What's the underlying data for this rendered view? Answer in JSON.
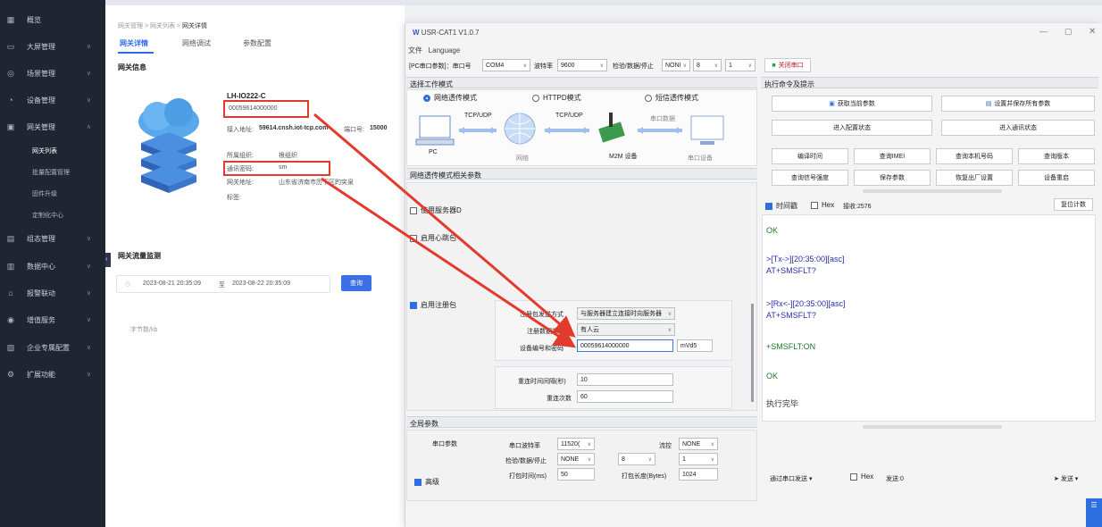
{
  "sidebar": {
    "items": [
      {
        "icon": "grid-icon",
        "label": "概览"
      },
      {
        "icon": "monitor-icon",
        "label": "大屏管理"
      },
      {
        "icon": "scene-icon",
        "label": "场景管理"
      },
      {
        "icon": "device-icon",
        "label": "设备管理"
      },
      {
        "icon": "gateway-icon",
        "label": "网关管理"
      },
      {
        "icon": "template-icon",
        "label": "组态管理"
      },
      {
        "icon": "chart-icon",
        "label": "数据中心"
      },
      {
        "icon": "alarm-icon",
        "label": "报警联动"
      },
      {
        "icon": "service-icon",
        "label": "增值服务"
      },
      {
        "icon": "enterprise-icon",
        "label": "企业专属配置"
      },
      {
        "icon": "plugin-icon",
        "label": "扩展功能"
      }
    ],
    "sub_items": [
      "网关列表",
      "批量配置管理",
      "固件升级",
      "定制化中心"
    ]
  },
  "breadcrumb": [
    "网关管理",
    "网关列表",
    "网关详情"
  ],
  "tabs": [
    "网关详情",
    "网络调试",
    "参数配置"
  ],
  "gateway_info": {
    "section": "网关信息",
    "model": "LH-IO222-C",
    "serial": "00059614000000",
    "access_addr_label": "接入地址:",
    "access_addr": "59614.cnsh.iot-tcp.com",
    "port_label": "端口号:",
    "port": "15000",
    "org_label": "所属组织:",
    "org": "根组织",
    "pass_label": "通讯密码:",
    "pass": "sm",
    "addr_label": "网关地址:",
    "addr": "山东省济南市历下区趵突泉",
    "tag_label": "标签:"
  },
  "traffic": {
    "section": "网关流量监测",
    "date_from": "2023-08-21 20:35:09",
    "sep": "至",
    "date_to": "2023-08-22 20:35:09",
    "query": "查询",
    "empty": "字节数/kb"
  },
  "window": {
    "title": "USR-CAT1 V1.0.7",
    "menu": [
      "文件",
      "Language"
    ],
    "port_label": "[PC串口参数]：串口号",
    "port": "COM4",
    "baud_label": "波特率",
    "baud": "9600",
    "parity_label": "检验/数据/停止",
    "parity": "NONI",
    "databits": "8",
    "stopbits": "1",
    "close_port": "关闭串口",
    "work_mode_title": "选择工作模式",
    "modes": [
      "网络透传模式",
      "HTTPD模式",
      "短信透传模式"
    ],
    "diagram": {
      "pc": "PC",
      "net": "网络",
      "dev": "M2M 设备",
      "serial_dev": "串口设备",
      "tcp1": "TCP/UDP",
      "tcp2": "TCP/UDP",
      "serial_data": "串口数据"
    },
    "net_params_title": "网络透传模式相关参数",
    "server_d": "使用服务器D",
    "heartbeat": "启用心跳包",
    "reg_pkg": "启用注册包",
    "reg_send_label": "注册包发送方式",
    "reg_send": "与服务器建立连接时向服务器",
    "reg_data_label": "注册数据类型",
    "reg_data": "有人云",
    "dev_id_label": "设备编号和密码",
    "dev_id": "00059614000000",
    "dev_pw": "mVd5",
    "reconnect_label": "重连时间间隔(秒)",
    "reconnect": "10",
    "retries_label": "重连次数",
    "retries": "60",
    "global_title": "全局参数",
    "serial_param": "串口参数",
    "s_baud_label": "串口波特率",
    "s_baud": "11520(",
    "flow_label": "流控",
    "flow": "NONE",
    "s_parity_label": "检验/数据/停止",
    "s_parity": "NONE",
    "s_data": "8",
    "s_stop": "1",
    "pack_time_label": "打包时间(ms)",
    "pack_time": "50",
    "pack_len_label": "打包长度(Bytes)",
    "pack_len": "1024",
    "advanced": "高级",
    "cmd_title": "执行命令及提示",
    "btn_get": "获取当前参数",
    "btn_save_all": "设置并保存所有参数",
    "btn_config": "进入配置状态",
    "btn_comm": "进入通讯状态",
    "grid_btns": [
      "编译时间",
      "查询IMEI",
      "查询本机号码",
      "查询版本",
      "查询信号强度",
      "保存参数",
      "恢复出厂设置",
      "设备重启"
    ],
    "timestamp": "时间戳",
    "hex": "Hex",
    "recv": "接收:2576",
    "clear": "复位计数",
    "log": [
      "OK",
      ">[Tx->][20:35:00][asc]",
      "AT+SMSFLT?",
      ">[Rx<-][20:35:00][asc]",
      "AT+SMSFLT?",
      "+SMSFLT:ON",
      "OK",
      "执行完毕"
    ],
    "send_via": "通过串口发送",
    "send_hex": "Hex",
    "sent": "发送:0",
    "send": "发送",
    "colors": {
      "accent": "#2d6fe0",
      "arrow": "#e23b2e"
    }
  }
}
